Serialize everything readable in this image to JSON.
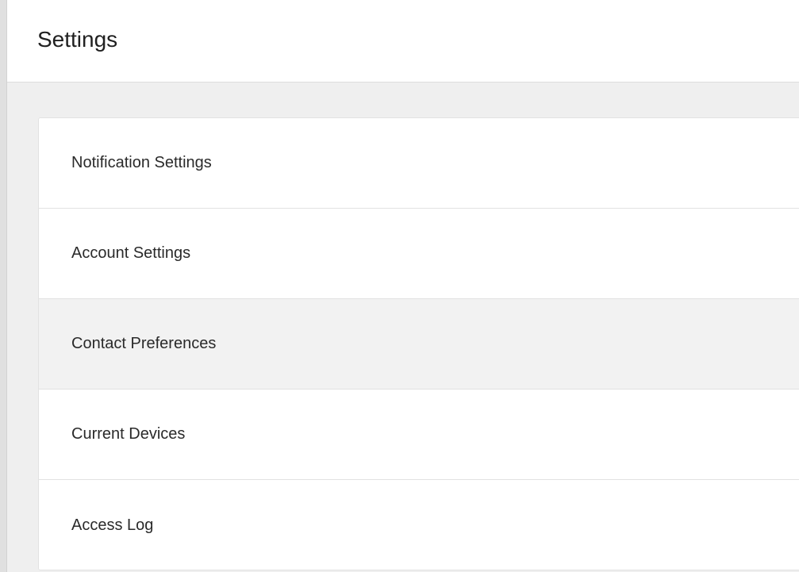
{
  "header": {
    "title": "Settings"
  },
  "settings": {
    "items": [
      {
        "label": "Notification Settings",
        "hovered": false
      },
      {
        "label": "Account Settings",
        "hovered": false
      },
      {
        "label": "Contact Preferences",
        "hovered": true
      },
      {
        "label": "Current Devices",
        "hovered": false
      },
      {
        "label": "Access Log",
        "hovered": false
      }
    ]
  },
  "colors": {
    "background": "#efefef",
    "card": "#ffffff",
    "hover": "#f2f2f2",
    "divider": "#e2e2e2",
    "text": "#2a2a2a"
  }
}
